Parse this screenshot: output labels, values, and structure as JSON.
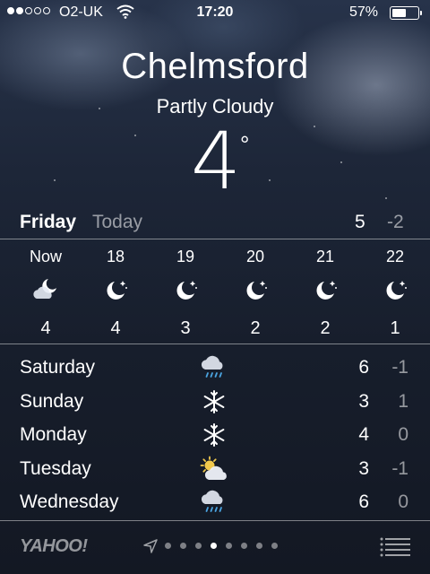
{
  "status_bar": {
    "carrier": "O2-UK",
    "time": "17:20",
    "battery_pct_text": "57%",
    "battery_level": 0.57,
    "signal_bars_filled": 2,
    "signal_bars_total": 5
  },
  "location": {
    "city": "Chelmsford",
    "condition": "Partly Cloudy",
    "temperature": "4",
    "degree_symbol": "°"
  },
  "today": {
    "day": "Friday",
    "label": "Today",
    "high": "5",
    "low": "-2"
  },
  "hourly": [
    {
      "time": "Now",
      "icon": "partly-cloudy-night-icon",
      "temp": "4"
    },
    {
      "time": "18",
      "icon": "clear-night-icon",
      "temp": "4"
    },
    {
      "time": "19",
      "icon": "clear-night-icon",
      "temp": "3"
    },
    {
      "time": "20",
      "icon": "clear-night-icon",
      "temp": "2"
    },
    {
      "time": "21",
      "icon": "clear-night-icon",
      "temp": "2"
    },
    {
      "time": "22",
      "icon": "clear-night-icon",
      "temp": "1"
    }
  ],
  "daily": [
    {
      "day": "Saturday",
      "icon": "rain-icon",
      "high": "6",
      "low": "-1"
    },
    {
      "day": "Sunday",
      "icon": "snow-icon",
      "high": "3",
      "low": "1"
    },
    {
      "day": "Monday",
      "icon": "snow-icon",
      "high": "4",
      "low": "0"
    },
    {
      "day": "Tuesday",
      "icon": "partly-sunny-icon",
      "high": "3",
      "low": "-1"
    },
    {
      "day": "Wednesday",
      "icon": "rain-icon",
      "high": "6",
      "low": "0"
    }
  ],
  "footer": {
    "brand": "YAHOO!",
    "page_count": 8,
    "active_page": 3
  },
  "colors": {
    "text": "#ffffff",
    "muted_text": "#ffffff8c",
    "sun": "#f2c94c",
    "rain": "#4aa3df"
  }
}
